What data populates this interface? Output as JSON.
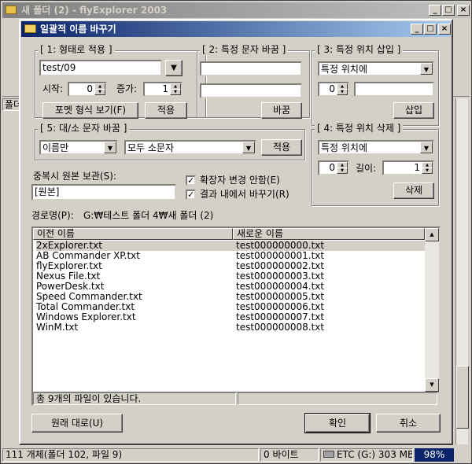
{
  "outer_window": {
    "title": "새 폴더 (2) - flyExplorer 2003",
    "sidebar_tab": "폴더",
    "status_bar": [
      "111 개체(폴더 102, 파일 9)",
      "0 바이트",
      "ETC (G:) 303 MB",
      "98%"
    ]
  },
  "dialog": {
    "title": "일괄적 이름 바꾸기",
    "format": {
      "legend": "[ 1: 형태로 적용 ]",
      "pattern": "test/09",
      "start_label": "시작:",
      "start_value": "0",
      "increment_label": "증가:",
      "increment_value": "1",
      "format_button": "포멧 형식 보기(F)",
      "apply_button": "적용"
    },
    "replace": {
      "legend": "[ 2: 특정 문자 바꿈 ]",
      "find_value": "",
      "replace_value": "",
      "button": "바꿈"
    },
    "insert": {
      "legend": "[ 3: 특정 위치 삽입 ]",
      "position_option": "특정 위치에",
      "position_value": "0",
      "text_value": "",
      "button": "삽입"
    },
    "case": {
      "legend": "[ 5: 대/소 문자 바꿈 ]",
      "scope_option": "이름만",
      "case_option": "모두 소문자",
      "apply_button": "적용"
    },
    "delete": {
      "legend": "[ 4: 특정 위치 삭제 ]",
      "position_option": "특정 위치에",
      "position_value": "0",
      "length_label": "길이:",
      "length_value": "1",
      "button": "삭제"
    },
    "backup": {
      "label": "중복시 원본 보관(S):",
      "value": "[원본]"
    },
    "options": {
      "keep_extension": "확장자 변경 안함(E)",
      "keep_extension_checked": true,
      "replace_in_results": "결과 내에서 바꾸기(R)",
      "replace_in_results_checked": true
    },
    "path": {
      "label": "경로명(P):",
      "value": "G:₩테스트 폴더 4₩새 폴더 (2)"
    },
    "file_list": {
      "columns": [
        "이전 이름",
        "새로운 이름"
      ],
      "rows": [
        {
          "old": "2xExplorer.txt",
          "new": "test000000000.txt"
        },
        {
          "old": "AB Commander XP.txt",
          "new": "test000000001.txt"
        },
        {
          "old": "flyExplorer.txt",
          "new": "test000000002.txt"
        },
        {
          "old": "Nexus File.txt",
          "new": "test000000003.txt"
        },
        {
          "old": "PowerDesk.txt",
          "new": "test000000004.txt"
        },
        {
          "old": "Speed Commander.txt",
          "new": "test000000005.txt"
        },
        {
          "old": "Total Commander.txt",
          "new": "test000000006.txt"
        },
        {
          "old": "Windows Explorer.txt",
          "new": "test000000007.txt"
        },
        {
          "old": "WinM.txt",
          "new": "test000000008.txt"
        }
      ],
      "status": "총 9개의 파일이 있습니다."
    },
    "restore_button": "원래 대로(U)",
    "ok_button": "확인",
    "cancel_button": "취소"
  }
}
